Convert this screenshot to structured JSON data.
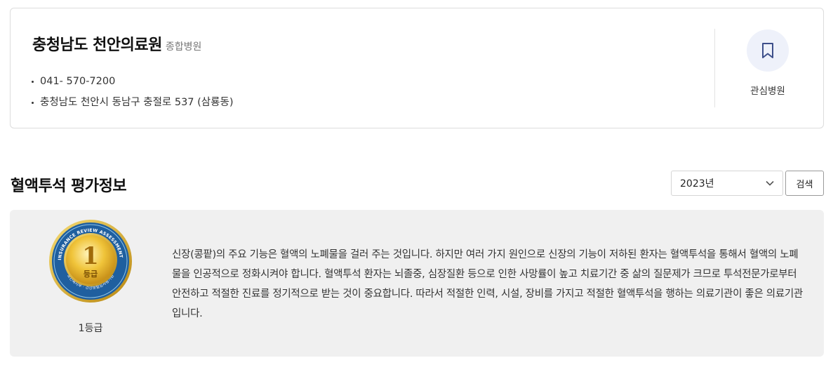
{
  "hospital": {
    "name": "충청남도 천안의료원",
    "type": "종합병원",
    "phone": "041- 570-7200",
    "address": "충청남도 천안시 동남구 충절로 537 (삼룡동)",
    "favorite_label": "관심병원",
    "favorite_icon": "bookmark-icon"
  },
  "section": {
    "title": "혈액투석 평가정보",
    "year_selected": "2023년",
    "search_label": "검색"
  },
  "evaluation": {
    "grade_number": "1",
    "grade_badge_text": "등급",
    "grade_label": "1등급",
    "badge_ring_text": "HEALTH INSURANCE REVIEW ASSESSMENT SERVICE",
    "badge_bottom_text": "보건복지부 · 건강보험심사평가원",
    "description": "신장(콩팥)의 주요 기능은 혈액의 노폐물을 걸러 주는 것입니다. 하지만 여러 가지 원인으로 신장의 기능이 저하된 환자는 혈액투석을 통해서 혈액의 노폐물을 인공적으로 정화시켜야 합니다. 혈액투석 환자는 뇌졸중, 심장질환 등으로 인한 사망률이 높고 치료기간 중 삶의 질문제가 크므로 투석전문가로부터 안전하고 적절한 진료를 정기적으로 받는 것이 중요합니다. 따라서 적절한 인력, 시설, 장비를 가지고 적절한 혈액투석을 행하는 의료기관이 좋은 의료기관입니다."
  },
  "colors": {
    "badge_blue": "#1f5f9f",
    "badge_gold": "#e8b92a",
    "bookmark_bg": "#eef1fa",
    "bookmark_stroke": "#3d4f8a"
  }
}
